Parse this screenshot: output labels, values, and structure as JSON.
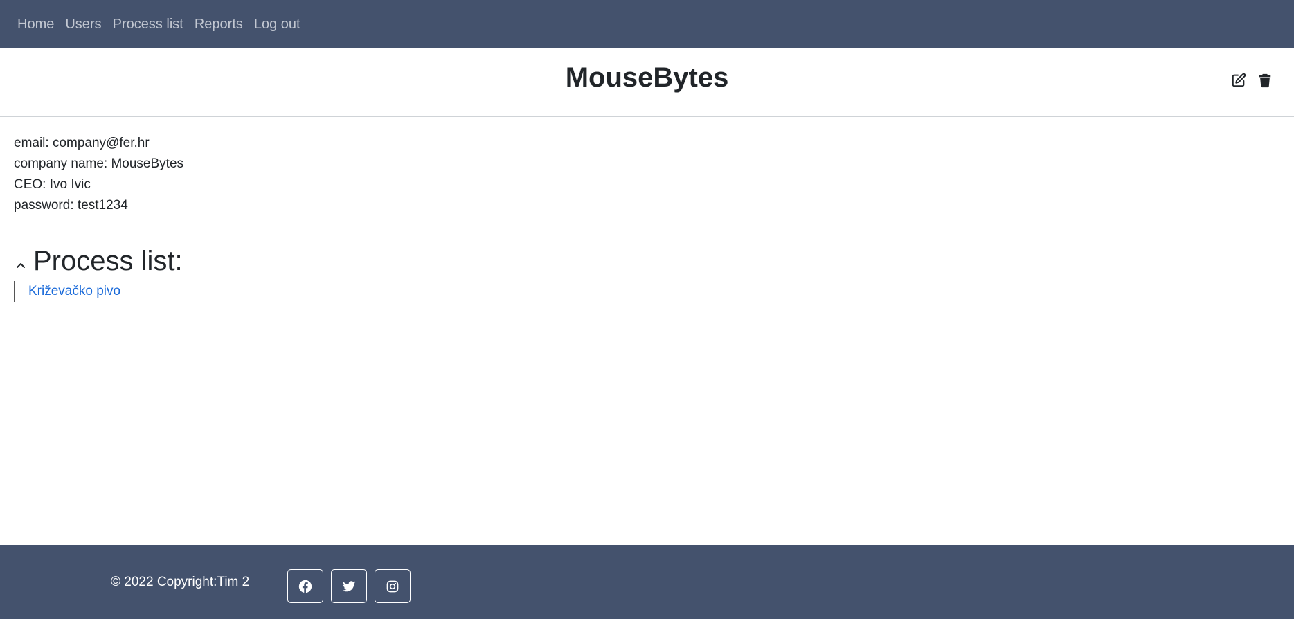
{
  "nav": {
    "items": [
      {
        "label": "Home"
      },
      {
        "label": "Users"
      },
      {
        "label": "Process list"
      },
      {
        "label": "Reports"
      },
      {
        "label": "Log out"
      }
    ]
  },
  "header": {
    "title": "MouseBytes",
    "icons": [
      "edit-icon",
      "trash-icon"
    ]
  },
  "info": {
    "email": "email: company@fer.hr",
    "company_name": "company name: MouseBytes",
    "ceo": "CEO: Ivo Ivic",
    "password": "password: test1234"
  },
  "process_list": {
    "title": "Process list:",
    "items": [
      {
        "label": "Križevačko pivo"
      }
    ]
  },
  "footer": {
    "copyright": "© 2022 Copyright:Tim 2",
    "social": [
      "facebook-icon",
      "twitter-icon",
      "instagram-icon"
    ]
  },
  "colors": {
    "navbar_bg": "#44526d",
    "link": "#1a6ad9",
    "nav_text": "#c3c8d2"
  }
}
